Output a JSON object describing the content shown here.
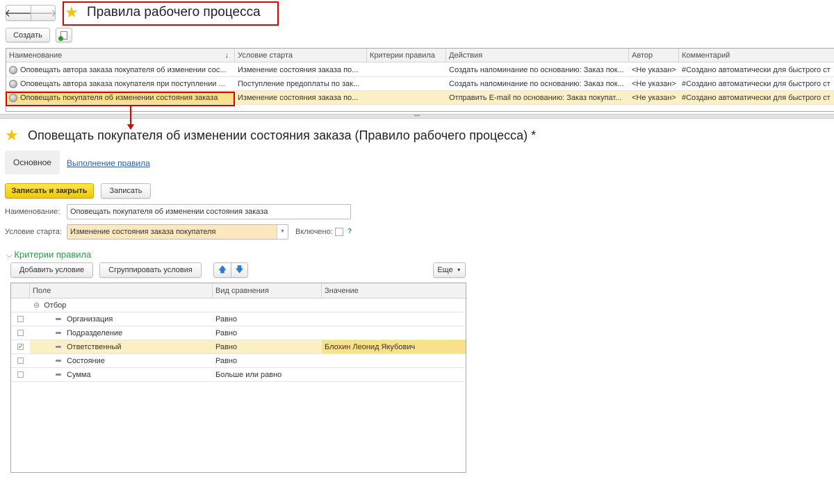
{
  "header": {
    "title": "Правила рабочего процесса",
    "create_label": "Создать"
  },
  "list": {
    "columns": [
      "Наименование",
      "Условие старта",
      "Критерии правила",
      "Действия",
      "Автор",
      "Комментарий"
    ],
    "sort_indicator": "↓",
    "rows": [
      {
        "name": "Оповещать автора заказа покупателя об изменении сос...",
        "start": "Изменение состояния заказа по...",
        "criteria": "",
        "actions": "Создать напоминание по основанию: Заказ пок...",
        "author": "<Не указан>",
        "comment": "#Создано автоматически для быстрого ст"
      },
      {
        "name": "Оповещать автора заказа покупателя при поступлении ...",
        "start": "Поступление предоплаты по зак...",
        "criteria": "",
        "actions": "Создать напоминание по основанию: Заказ пок...",
        "author": "<Не указан>",
        "comment": "#Создано автоматически для быстрого ст"
      },
      {
        "name": "Оповещать покупателя об изменении состояния заказа",
        "start": "Изменение состояния заказа по...",
        "criteria": "",
        "actions": "Отправить E-mail по основанию: Заказ покупат...",
        "author": "<Не указан>",
        "comment": "#Создано автоматически для быстрого ст"
      }
    ]
  },
  "form": {
    "title": "Оповещать покупателя об изменении состояния заказа (Правило рабочего процесса) *",
    "tabs": [
      "Основное",
      "Выполнение правила"
    ],
    "save_close_label": "Записать и закрыть",
    "save_label": "Записать",
    "name_label": "Наименование:",
    "name_value": "Оповещать покупателя об изменении состояния заказа",
    "start_label": "Условие старта:",
    "start_value": "Изменение состояния заказа покупателя",
    "enabled_label": "Включено:",
    "help": "?",
    "section_title": "Критерии правила",
    "add_condition": "Добавить условие",
    "group_conditions": "Сгруппировать условия",
    "more": "Еще",
    "columns": [
      "Поле",
      "Вид сравнения",
      "Значение"
    ],
    "group": "Отбор",
    "rows": [
      {
        "field": "Организация",
        "cmp": "Равно",
        "value": "",
        "checked": false
      },
      {
        "field": "Подразделение",
        "cmp": "Равно",
        "value": "",
        "checked": false
      },
      {
        "field": "Ответственный",
        "cmp": "Равно",
        "value": "Блохин Леонид Якубович",
        "checked": true
      },
      {
        "field": "Состояние",
        "cmp": "Равно",
        "value": "",
        "checked": false
      },
      {
        "field": "Сумма",
        "cmp": "Больше или равно",
        "value": "",
        "checked": false
      }
    ]
  },
  "colors": {
    "accent_yellow": "#f5d100",
    "highlight": "#fbf0c5",
    "annotation_red": "#e00000",
    "section_green": "#2a9a4a"
  }
}
